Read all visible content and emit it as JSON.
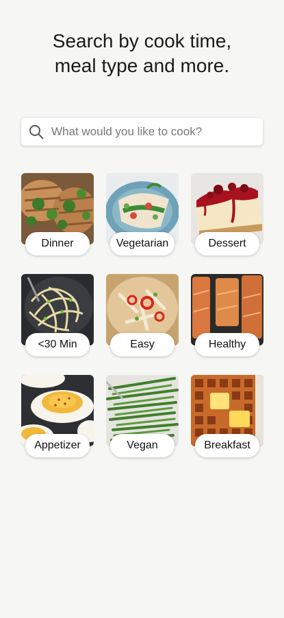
{
  "header": {
    "title_line1": "Search by cook time,",
    "title_line2": "meal type and more."
  },
  "search": {
    "placeholder": "What would you like to cook?",
    "icon": "search-icon"
  },
  "categories": [
    {
      "label": "Dinner"
    },
    {
      "label": "Vegetarian"
    },
    {
      "label": "Dessert"
    },
    {
      "label": "<30 Min"
    },
    {
      "label": "Easy"
    },
    {
      "label": "Healthy"
    },
    {
      "label": "Appetizer"
    },
    {
      "label": "Vegan"
    },
    {
      "label": "Breakfast"
    }
  ],
  "colors": {
    "background": "#f6f6f4",
    "pill": "#ffffff",
    "text": "#111111"
  }
}
